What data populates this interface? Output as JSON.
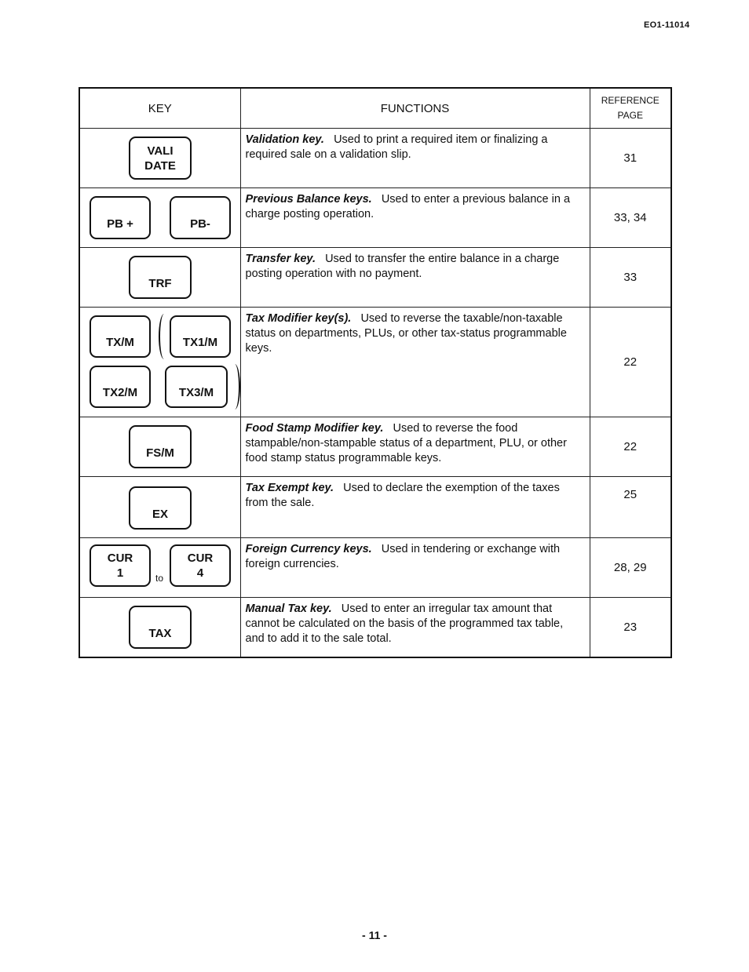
{
  "header": {
    "doc_code": "EO1-11014"
  },
  "table": {
    "columns": {
      "key": "KEY",
      "functions": "FUNCTIONS",
      "reference_line1": "REFERENCE",
      "reference_line2": "PAGE"
    },
    "rows": [
      {
        "keys": [
          [
            "VALI",
            "DATE"
          ]
        ],
        "title": "Validation key.",
        "description": "Used to print a required item or finalizing a required sale on a validation slip.",
        "ref": "31"
      },
      {
        "keys": [
          [
            "PB +"
          ],
          [
            "PB-"
          ]
        ],
        "title": "Previous Balance keys.",
        "description": "Used to enter a previous balance in a charge posting operation.",
        "ref": "33, 34"
      },
      {
        "keys": [
          [
            "TRF"
          ]
        ],
        "title": "Transfer key.",
        "description": "Used to transfer the entire balance in a charge posting operation with no payment.",
        "ref": "33"
      },
      {
        "keys": [
          [
            "TX/M"
          ],
          [
            "TX1/M"
          ],
          [
            "TX2/M"
          ],
          [
            "TX3/M"
          ]
        ],
        "title": "Tax Modifier key(s).",
        "description": "Used to reverse the taxable/non-taxable status on departments, PLUs, or other tax-status programmable keys.",
        "ref": "22"
      },
      {
        "keys": [
          [
            "FS/M"
          ]
        ],
        "title": "Food Stamp Modifier key.",
        "description": "Used to reverse the food stampable/non-stampable status of a department, PLU, or other food stamp status programmable keys.",
        "ref": "22"
      },
      {
        "keys": [
          [
            "EX"
          ]
        ],
        "title": "Tax Exempt key.",
        "description": "Used to declare the exemption of the taxes from the sale.",
        "ref": "25"
      },
      {
        "keys": [
          [
            "CUR",
            "1"
          ],
          [
            "CUR",
            "4"
          ]
        ],
        "connector": "to",
        "title": "Foreign Currency keys.",
        "description": "Used in tendering or exchange with foreign currencies.",
        "ref": "28, 29"
      },
      {
        "keys": [
          [
            "TAX"
          ]
        ],
        "title": "Manual Tax key.",
        "description": "Used to enter an irregular tax amount that cannot be calculated on the basis of the programmed tax table, and to add it to the sale total.",
        "ref": "23"
      }
    ]
  },
  "footer": {
    "page_number": "- 11 -"
  }
}
